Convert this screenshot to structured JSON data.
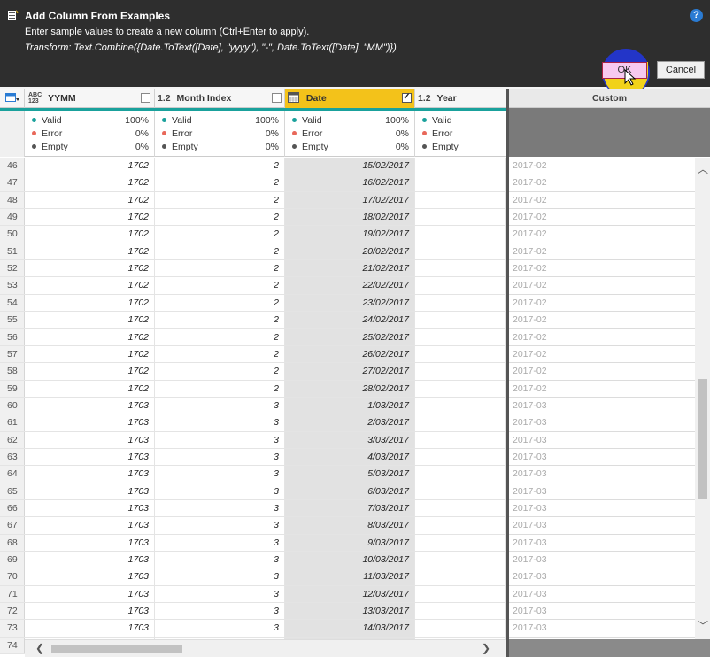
{
  "dialog": {
    "title": "Add Column From Examples",
    "help_glyph": "?",
    "description": "Enter sample values to create a new column (Ctrl+Enter to apply).",
    "transform": "Transform: Text.Combine({Date.ToText([Date], \"yyyy\"), \"-\", Date.ToText([Date], \"MM\")})",
    "ok_label": "OK",
    "cancel_label": "Cancel"
  },
  "columns": [
    {
      "type": "ABC\n123",
      "type_display": "ABC 123",
      "name": "YYMM"
    },
    {
      "type": "1.2",
      "name": "Month Index"
    },
    {
      "type": "calendar-icon",
      "name": "Date",
      "selected": true
    },
    {
      "type": "1.2",
      "name": "Year"
    }
  ],
  "profile_labels": {
    "valid": "Valid",
    "error": "Error",
    "empty": "Empty"
  },
  "profiles": [
    {
      "valid": "100%",
      "error": "0%",
      "empty": "0%"
    },
    {
      "valid": "100%",
      "error": "0%",
      "empty": "0%"
    },
    {
      "valid": "100%",
      "error": "0%",
      "empty": "0%"
    },
    {
      "valid": "",
      "error": "",
      "empty": ""
    }
  ],
  "colors": {
    "valid": "#1aa19c",
    "error": "#e8685a",
    "empty": "#555555",
    "selected_header": "#f3c21a",
    "accent": "#1aa19c"
  },
  "rows": [
    {
      "n": "46",
      "yymm": "1702",
      "mi": "2",
      "date": "15/02/2017",
      "custom": "2017-02"
    },
    {
      "n": "47",
      "yymm": "1702",
      "mi": "2",
      "date": "16/02/2017",
      "custom": "2017-02"
    },
    {
      "n": "48",
      "yymm": "1702",
      "mi": "2",
      "date": "17/02/2017",
      "custom": "2017-02"
    },
    {
      "n": "49",
      "yymm": "1702",
      "mi": "2",
      "date": "18/02/2017",
      "custom": "2017-02"
    },
    {
      "n": "50",
      "yymm": "1702",
      "mi": "2",
      "date": "19/02/2017",
      "custom": "2017-02"
    },
    {
      "n": "51",
      "yymm": "1702",
      "mi": "2",
      "date": "20/02/2017",
      "custom": "2017-02"
    },
    {
      "n": "52",
      "yymm": "1702",
      "mi": "2",
      "date": "21/02/2017",
      "custom": "2017-02"
    },
    {
      "n": "53",
      "yymm": "1702",
      "mi": "2",
      "date": "22/02/2017",
      "custom": "2017-02"
    },
    {
      "n": "54",
      "yymm": "1702",
      "mi": "2",
      "date": "23/02/2017",
      "custom": "2017-02"
    },
    {
      "n": "55",
      "yymm": "1702",
      "mi": "2",
      "date": "24/02/2017",
      "custom": "2017-02"
    },
    {
      "n": "56",
      "yymm": "1702",
      "mi": "2",
      "date": "25/02/2017",
      "custom": "2017-02"
    },
    {
      "n": "57",
      "yymm": "1702",
      "mi": "2",
      "date": "26/02/2017",
      "custom": "2017-02"
    },
    {
      "n": "58",
      "yymm": "1702",
      "mi": "2",
      "date": "27/02/2017",
      "custom": "2017-02"
    },
    {
      "n": "59",
      "yymm": "1702",
      "mi": "2",
      "date": "28/02/2017",
      "custom": "2017-02"
    },
    {
      "n": "60",
      "yymm": "1703",
      "mi": "3",
      "date": "1/03/2017",
      "custom": "2017-03"
    },
    {
      "n": "61",
      "yymm": "1703",
      "mi": "3",
      "date": "2/03/2017",
      "custom": "2017-03"
    },
    {
      "n": "62",
      "yymm": "1703",
      "mi": "3",
      "date": "3/03/2017",
      "custom": "2017-03"
    },
    {
      "n": "63",
      "yymm": "1703",
      "mi": "3",
      "date": "4/03/2017",
      "custom": "2017-03"
    },
    {
      "n": "64",
      "yymm": "1703",
      "mi": "3",
      "date": "5/03/2017",
      "custom": "2017-03"
    },
    {
      "n": "65",
      "yymm": "1703",
      "mi": "3",
      "date": "6/03/2017",
      "custom": "2017-03"
    },
    {
      "n": "66",
      "yymm": "1703",
      "mi": "3",
      "date": "7/03/2017",
      "custom": "2017-03"
    },
    {
      "n": "67",
      "yymm": "1703",
      "mi": "3",
      "date": "8/03/2017",
      "custom": "2017-03"
    },
    {
      "n": "68",
      "yymm": "1703",
      "mi": "3",
      "date": "9/03/2017",
      "custom": "2017-03"
    },
    {
      "n": "69",
      "yymm": "1703",
      "mi": "3",
      "date": "10/03/2017",
      "custom": "2017-03"
    },
    {
      "n": "70",
      "yymm": "1703",
      "mi": "3",
      "date": "11/03/2017",
      "custom": "2017-03"
    },
    {
      "n": "71",
      "yymm": "1703",
      "mi": "3",
      "date": "12/03/2017",
      "custom": "2017-03"
    },
    {
      "n": "72",
      "yymm": "1703",
      "mi": "3",
      "date": "13/03/2017",
      "custom": "2017-03"
    },
    {
      "n": "73",
      "yymm": "1703",
      "mi": "3",
      "date": "14/03/2017",
      "custom": "2017-03"
    },
    {
      "n": "74",
      "yymm": "",
      "mi": "",
      "date": "",
      "custom": ""
    }
  ],
  "custom_column": {
    "name": "Custom"
  }
}
